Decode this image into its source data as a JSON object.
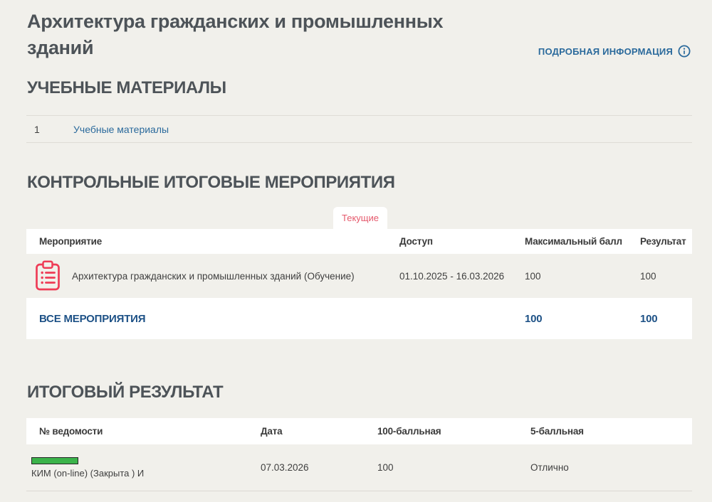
{
  "header": {
    "title": "Архитектура гражданских и промышленных зданий",
    "details_link": "ПОДРОБНАЯ ИНФОРМАЦИЯ"
  },
  "materials": {
    "heading": "УЧЕБНЫЕ МАТЕРИАЛЫ",
    "rows": [
      {
        "num": "1",
        "label": "Учебные материалы"
      }
    ]
  },
  "control_events": {
    "heading": "КОНТРОЛЬНЫЕ ИТОГОВЫЕ МЕРОПРИЯТИЯ",
    "tab": "Текущие",
    "columns": [
      "Мероприятие",
      "Доступ",
      "Максимальный балл",
      "Результат"
    ],
    "rows": [
      {
        "icon": "clipboard-checklist-icon",
        "name": "Архитектура гражданских и промышленных зданий (Обучение)",
        "access": "01.10.2025 - 16.03.2026",
        "max_score": "100",
        "result": "100"
      }
    ],
    "footer": {
      "label": "ВСЕ МЕРОПРИЯТИЯ",
      "max_score": "100",
      "result": "100"
    }
  },
  "final_result": {
    "heading": "ИТОГОВЫЙ РЕЗУЛЬТАТ",
    "columns": [
      "№ ведомости",
      "Дата",
      "100-балльная",
      "5-балльная"
    ],
    "rows": [
      {
        "sheet": "КИМ (on-line) (Закрыта ) И",
        "date": "07.03.2026",
        "score_100": "100",
        "score_5": "Отлично"
      }
    ]
  },
  "colors": {
    "page_background": "#f1f0eb",
    "heading_text": "#4d5358",
    "link_blue": "#2b6a9c",
    "navy_bold": "#1d5186",
    "accent_red": "#ee3b56",
    "tab_red": "#e5596c",
    "grade_green": "#3bb34a"
  }
}
